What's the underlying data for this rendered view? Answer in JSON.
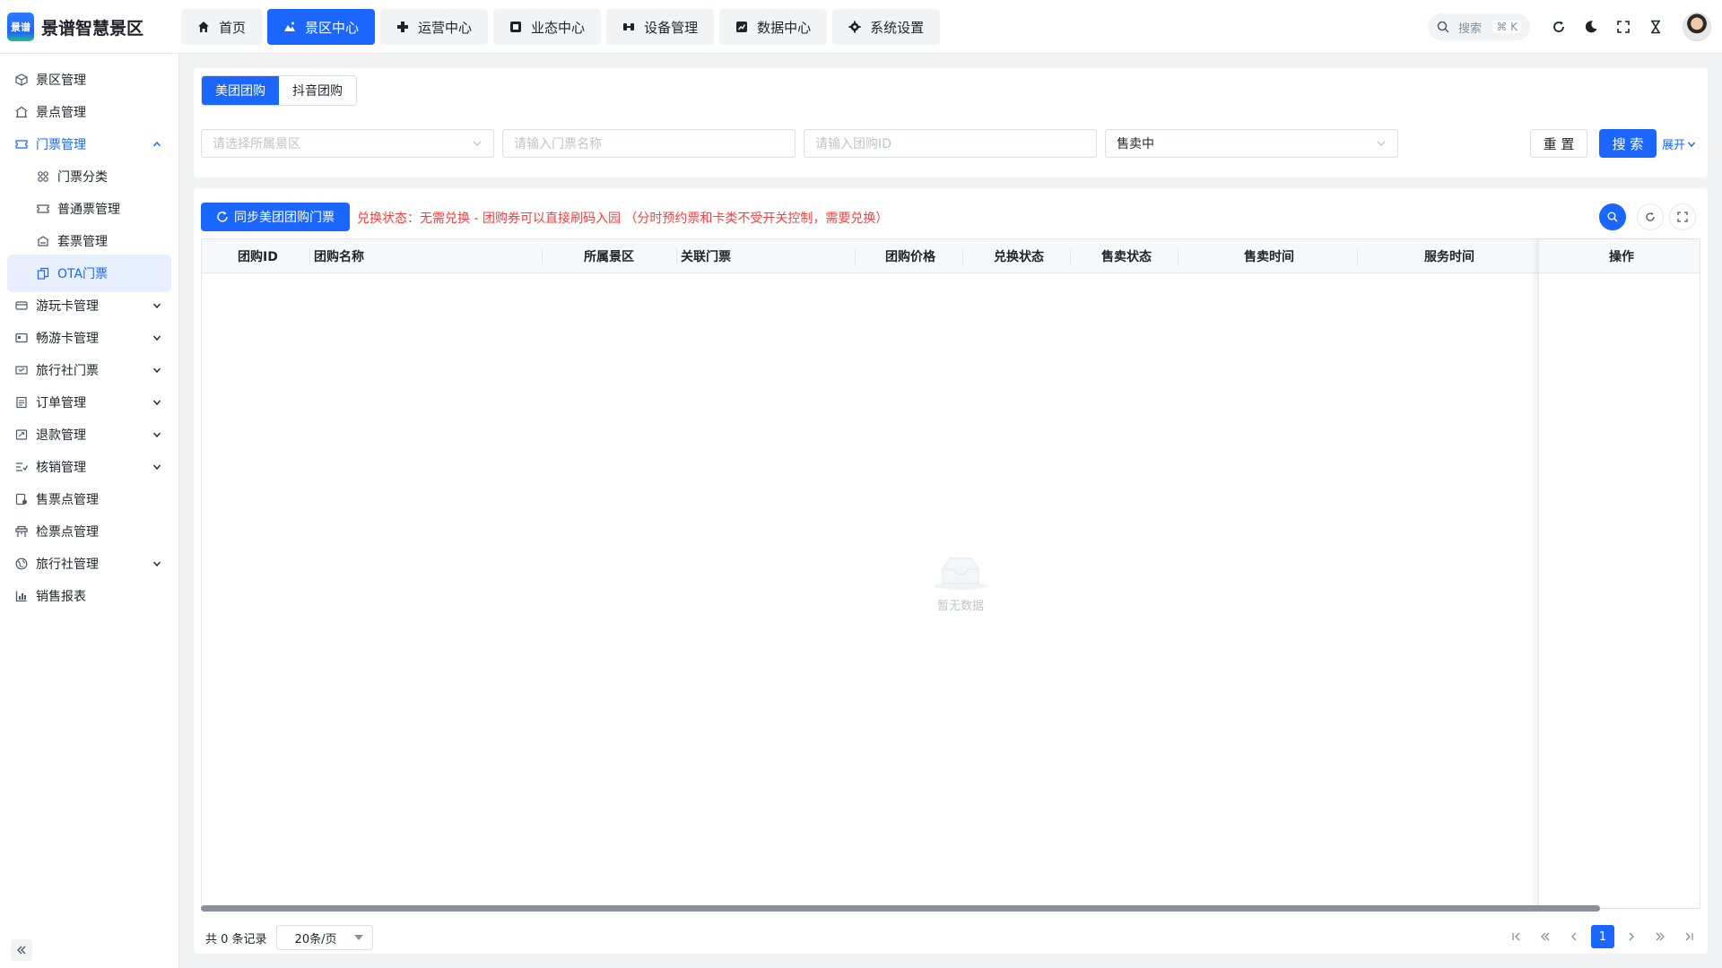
{
  "app": {
    "logo_text": "景谱",
    "title": "景谱智慧景区"
  },
  "nav": [
    {
      "label": "首页",
      "icon": "home-icon",
      "active": false
    },
    {
      "label": "景区中心",
      "icon": "landscape-icon",
      "active": true
    },
    {
      "label": "运营中心",
      "icon": "operations-icon",
      "active": false
    },
    {
      "label": "业态中心",
      "icon": "business-icon",
      "active": false
    },
    {
      "label": "设备管理",
      "icon": "device-icon",
      "active": false
    },
    {
      "label": "数据中心",
      "icon": "chart-icon",
      "active": false
    },
    {
      "label": "系统设置",
      "icon": "gear-icon",
      "active": false
    }
  ],
  "header_search": {
    "placeholder": "搜索",
    "shortcut": "⌘ K"
  },
  "sidebar": {
    "items": [
      {
        "label": "景区管理",
        "icon": "cube-icon"
      },
      {
        "label": "景点管理",
        "icon": "building-icon"
      },
      {
        "label": "门票管理",
        "icon": "ticket-icon",
        "open": true
      },
      {
        "label": "门票分类",
        "icon": "grid-icon",
        "sub": true
      },
      {
        "label": "普通票管理",
        "icon": "ticket-icon",
        "sub": true
      },
      {
        "label": "套票管理",
        "icon": "bundle-icon",
        "sub": true
      },
      {
        "label": "OTA门票",
        "icon": "ota-icon",
        "sub": true,
        "selected": true
      },
      {
        "label": "游玩卡管理",
        "icon": "card-icon",
        "expandable": true
      },
      {
        "label": "畅游卡管理",
        "icon": "card-icon",
        "expandable": true
      },
      {
        "label": "旅行社门票",
        "icon": "ticket-icon",
        "expandable": true
      },
      {
        "label": "订单管理",
        "icon": "list-icon",
        "expandable": true
      },
      {
        "label": "退款管理",
        "icon": "refund-icon",
        "expandable": true
      },
      {
        "label": "核销管理",
        "icon": "verify-icon",
        "expandable": true
      },
      {
        "label": "售票点管理",
        "icon": "store-icon"
      },
      {
        "label": "检票点管理",
        "icon": "gate-icon"
      },
      {
        "label": "旅行社管理",
        "icon": "globe-icon",
        "expandable": true
      },
      {
        "label": "销售报表",
        "icon": "report-icon"
      }
    ]
  },
  "filter": {
    "tabs": [
      {
        "label": "美团团购",
        "active": true
      },
      {
        "label": "抖音团购",
        "active": false
      }
    ],
    "scenic_placeholder": "请选择所属景区",
    "ticket_name_placeholder": "请输入门票名称",
    "group_id_placeholder": "请输入团购ID",
    "status_value": "售卖中",
    "reset_label": "重 置",
    "search_label": "搜 索",
    "expand_label": "展开"
  },
  "toolbar": {
    "sync_label": "同步美团团购门票",
    "notice": "兑换状态：无需兑换 - 团购券可以直接刷码入园 （分时预约票和卡类不受开关控制，需要兑换）"
  },
  "table": {
    "columns": [
      "团购ID",
      "团购名称",
      "所属景区",
      "关联门票",
      "团购价格",
      "兑换状态",
      "售卖状态",
      "售卖时间",
      "服务时间",
      "操作"
    ],
    "rows": [],
    "empty_text": "暂无数据"
  },
  "pagination": {
    "total_text": "共 0 条记录",
    "page_size": "20条/页",
    "current_page": "1"
  },
  "colors": {
    "primary": "#1b66ff",
    "danger": "#f53f3f",
    "background": "#f2f3f5"
  }
}
